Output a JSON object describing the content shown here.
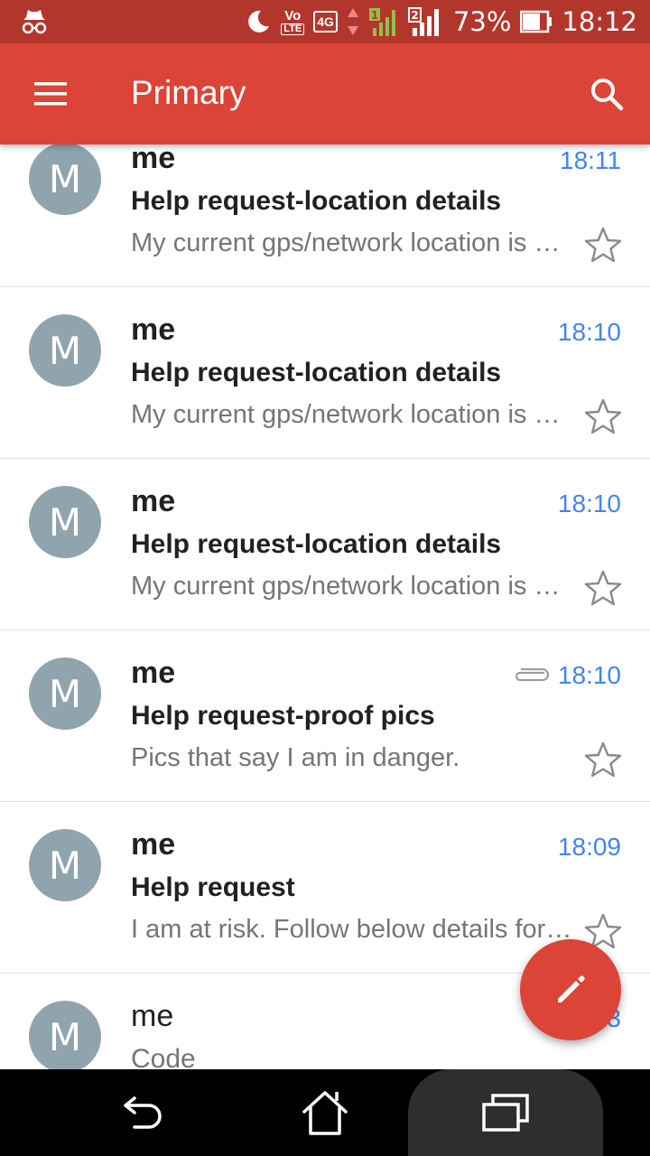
{
  "status_bar": {
    "battery_percent": "73%",
    "time": "18:12",
    "volte_top": "Vo",
    "volte_bottom": "LTE",
    "network": "4G",
    "sim1": "1",
    "sim2": "2",
    "icons": [
      "incognito-icon",
      "moon-icon",
      "volte-icon",
      "signal-icon",
      "battery-icon"
    ]
  },
  "toolbar": {
    "title": "Primary",
    "menu_icon": "menu-icon",
    "search_icon": "search-icon",
    "color": "#db4437"
  },
  "emails": [
    {
      "avatar": "M",
      "sender": "me",
      "time": "18:11",
      "subject": "Help request-location details",
      "snippet": "My current gps/network location is …",
      "attachment": false,
      "unread": true
    },
    {
      "avatar": "M",
      "sender": "me",
      "time": "18:10",
      "subject": "Help request-location details",
      "snippet": "My current gps/network location is …",
      "attachment": false,
      "unread": true
    },
    {
      "avatar": "M",
      "sender": "me",
      "time": "18:10",
      "subject": "Help request-location details",
      "snippet": "My current gps/network location is …",
      "attachment": false,
      "unread": true
    },
    {
      "avatar": "M",
      "sender": "me",
      "time": "18:10",
      "subject": "Help request-proof pics",
      "snippet": "Pics that say I am in danger.",
      "attachment": true,
      "unread": true
    },
    {
      "avatar": "M",
      "sender": "me",
      "time": "18:09",
      "subject": "Help request",
      "snippet": "I am at risk. Follow below details for…",
      "attachment": false,
      "unread": true
    },
    {
      "avatar": "M",
      "sender": "me",
      "time": "13",
      "subject": "Code",
      "snippet": "",
      "attachment": false,
      "unread": false
    }
  ],
  "fab": {
    "icon": "pencil-icon"
  },
  "nav": {
    "back_icon": "back-icon",
    "home_icon": "home-icon",
    "recents_icon": "recents-icon"
  },
  "colors": {
    "accent": "#db4437",
    "time": "#4285f4",
    "avatar": "#90a4ae",
    "status_bar": "#b3362c"
  }
}
